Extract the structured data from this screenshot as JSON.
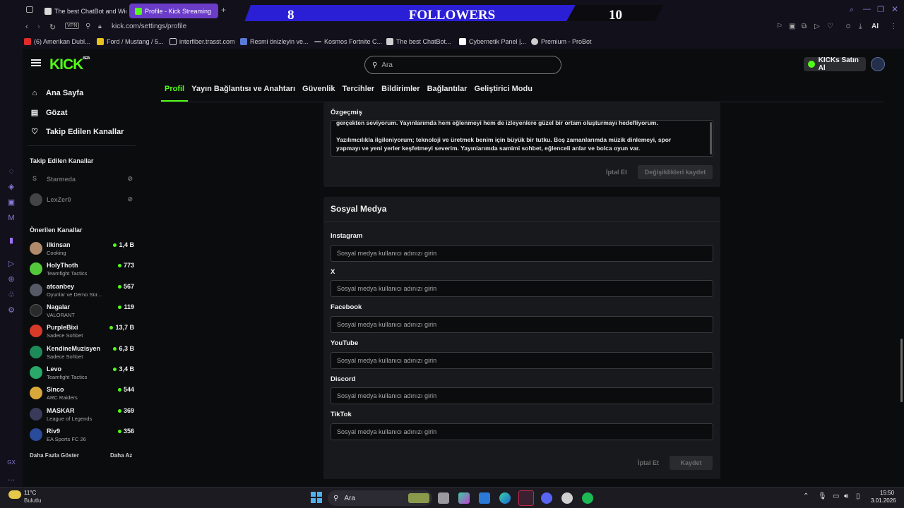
{
  "browser": {
    "tabs": [
      {
        "title": "The best ChatBot and Wid"
      },
      {
        "title": "Profile - Kick Streaming"
      }
    ],
    "followers_widget": {
      "left": "8",
      "label": "FOLLOWERS",
      "right": "10"
    },
    "url": "kick.com/settings/profile",
    "vpn": "VPN",
    "aria": "AI",
    "bookmarks": [
      {
        "label": "(6) Amerikan Dubl...",
        "color": "#e02b2b"
      },
      {
        "label": "Ford / Mustang / 5...",
        "color": "#e7c21d"
      },
      {
        "label": "interfiber.trasst.com",
        "color": "#cfcfcf"
      },
      {
        "label": "Resmi önizleyin ve...",
        "color": "#5a7ad8"
      },
      {
        "label": "Kosmos Fortnite C...",
        "color": "#888888"
      },
      {
        "label": "The best ChatBot...",
        "color": "#cfcfcf"
      },
      {
        "label": "Cybernetik Panel |...",
        "color": "#ffffff"
      },
      {
        "label": "Premium - ProBot",
        "color": "#cfcfcf"
      }
    ]
  },
  "site": {
    "logo": "KICK",
    "logo_sup": "BETA",
    "search_placeholder": "Ara",
    "buy_kicks": "KICKs Satın Al",
    "nav": [
      {
        "label": "Ana Sayfa",
        "icon": "home-icon"
      },
      {
        "label": "Gözat",
        "icon": "browse-icon"
      },
      {
        "label": "Takip Edilen Kanallar",
        "icon": "heart-icon"
      }
    ],
    "followed_title": "Takip Edilen Kanallar",
    "followed": [
      {
        "name": "Starmeda"
      },
      {
        "name": "LexZer0"
      }
    ],
    "recommended_title": "Önerilen Kanallar",
    "recommended": [
      {
        "name": "ilkinsan",
        "category": "Cooking",
        "viewers": "1,4 B",
        "color": "#b08a6a"
      },
      {
        "name": "HolyThoth",
        "category": "Teamfight Tactics",
        "viewers": "773",
        "color": "#53c83a"
      },
      {
        "name": "atcanbey",
        "category": "Oyunlar ve Demo Sür...",
        "viewers": "567",
        "color": "#555a66"
      },
      {
        "name": "Nagalar",
        "category": "VALORANT",
        "viewers": "119",
        "color": "#2a2a2a"
      },
      {
        "name": "PurpleBixi",
        "category": "Sadece Sohbet",
        "viewers": "13,7 B",
        "color": "#d83a2a"
      },
      {
        "name": "KendineMuzisyen",
        "category": "Sadece Sohbet",
        "viewers": "6,3 B",
        "color": "#1e8a5a"
      },
      {
        "name": "Levo",
        "category": "Teamfight Tactics",
        "viewers": "3,4 B",
        "color": "#2aa86a"
      },
      {
        "name": "Sinco",
        "category": "ARC Raiders",
        "viewers": "544",
        "color": "#d8a83a"
      },
      {
        "name": "MASKAR",
        "category": "League of Legends",
        "viewers": "369",
        "color": "#3a3a5a"
      },
      {
        "name": "Riv9",
        "category": "EA Sports FC 26",
        "viewers": "356",
        "color": "#2a4a9a"
      }
    ],
    "show_more": "Daha Fazla Göster",
    "show_less": "Daha Az",
    "settings_tabs": [
      "Profil",
      "Yayın Bağlantısı ve Anahtarı",
      "Güvenlik",
      "Tercihler",
      "Bildirimler",
      "Bağlantılar",
      "Geliştirici Modu"
    ],
    "bio": {
      "label": "Özgeçmiş",
      "line1": "gerçekten seviyorum. Yayınlarımda hem eğlenmeyi hem de izleyenlere güzel bir ortam oluşturmayı hedefliyorum.",
      "line2": "Yazılımcılıkla ilgileniyorum; teknoloji ve üretmek benim için büyük bir tutku. Boş zamanlarımda müzik dinlemeyi, spor",
      "line3": "yapmayı ve yeni yerler keşfetmeyi severim. Yayınlarımda samimi sohbet, eğlenceli anlar ve bolca oyun var.",
      "cancel": "İptal Et",
      "save": "Değişiklikleri kaydet"
    },
    "social": {
      "title": "Sosyal Medya",
      "placeholder": "Sosyal medya kullanıcı adınızı girin",
      "fields": [
        "Instagram",
        "X",
        "Facebook",
        "YouTube",
        "Discord",
        "TikTok"
      ],
      "cancel": "İptal Et",
      "save": "Kaydet"
    }
  },
  "taskbar": {
    "weather_temp": "11°C",
    "weather_desc": "Bulutlu",
    "search": "Ara",
    "time": "15:50",
    "date": "3.01.2026"
  }
}
